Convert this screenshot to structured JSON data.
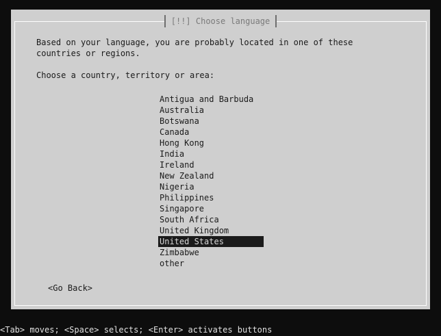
{
  "dialog": {
    "title": "[!!] Choose language",
    "description_line1": "Based on your language, you are probably located in one of these",
    "description_line2": "countries or regions.",
    "prompt": "Choose a country, territory or area:"
  },
  "countries": [
    {
      "label": "Antigua and Barbuda",
      "selected": false
    },
    {
      "label": "Australia",
      "selected": false
    },
    {
      "label": "Botswana",
      "selected": false
    },
    {
      "label": "Canada",
      "selected": false
    },
    {
      "label": "Hong Kong",
      "selected": false
    },
    {
      "label": "India",
      "selected": false
    },
    {
      "label": "Ireland",
      "selected": false
    },
    {
      "label": "New Zealand",
      "selected": false
    },
    {
      "label": "Nigeria",
      "selected": false
    },
    {
      "label": "Philippines",
      "selected": false
    },
    {
      "label": "Singapore",
      "selected": false
    },
    {
      "label": "South Africa",
      "selected": false
    },
    {
      "label": "United Kingdom",
      "selected": false
    },
    {
      "label": "United States",
      "selected": true
    },
    {
      "label": "Zimbabwe",
      "selected": false
    },
    {
      "label": "other",
      "selected": false
    }
  ],
  "buttons": {
    "go_back": "<Go Back>"
  },
  "status_bar": {
    "text": "<Tab> moves; <Space> selects; <Enter> activates buttons"
  },
  "colors": {
    "background": "#0d0d0d",
    "dialog": "#cfcfcf",
    "selection": "#1b1b1b",
    "text": "#1a1a1a"
  }
}
